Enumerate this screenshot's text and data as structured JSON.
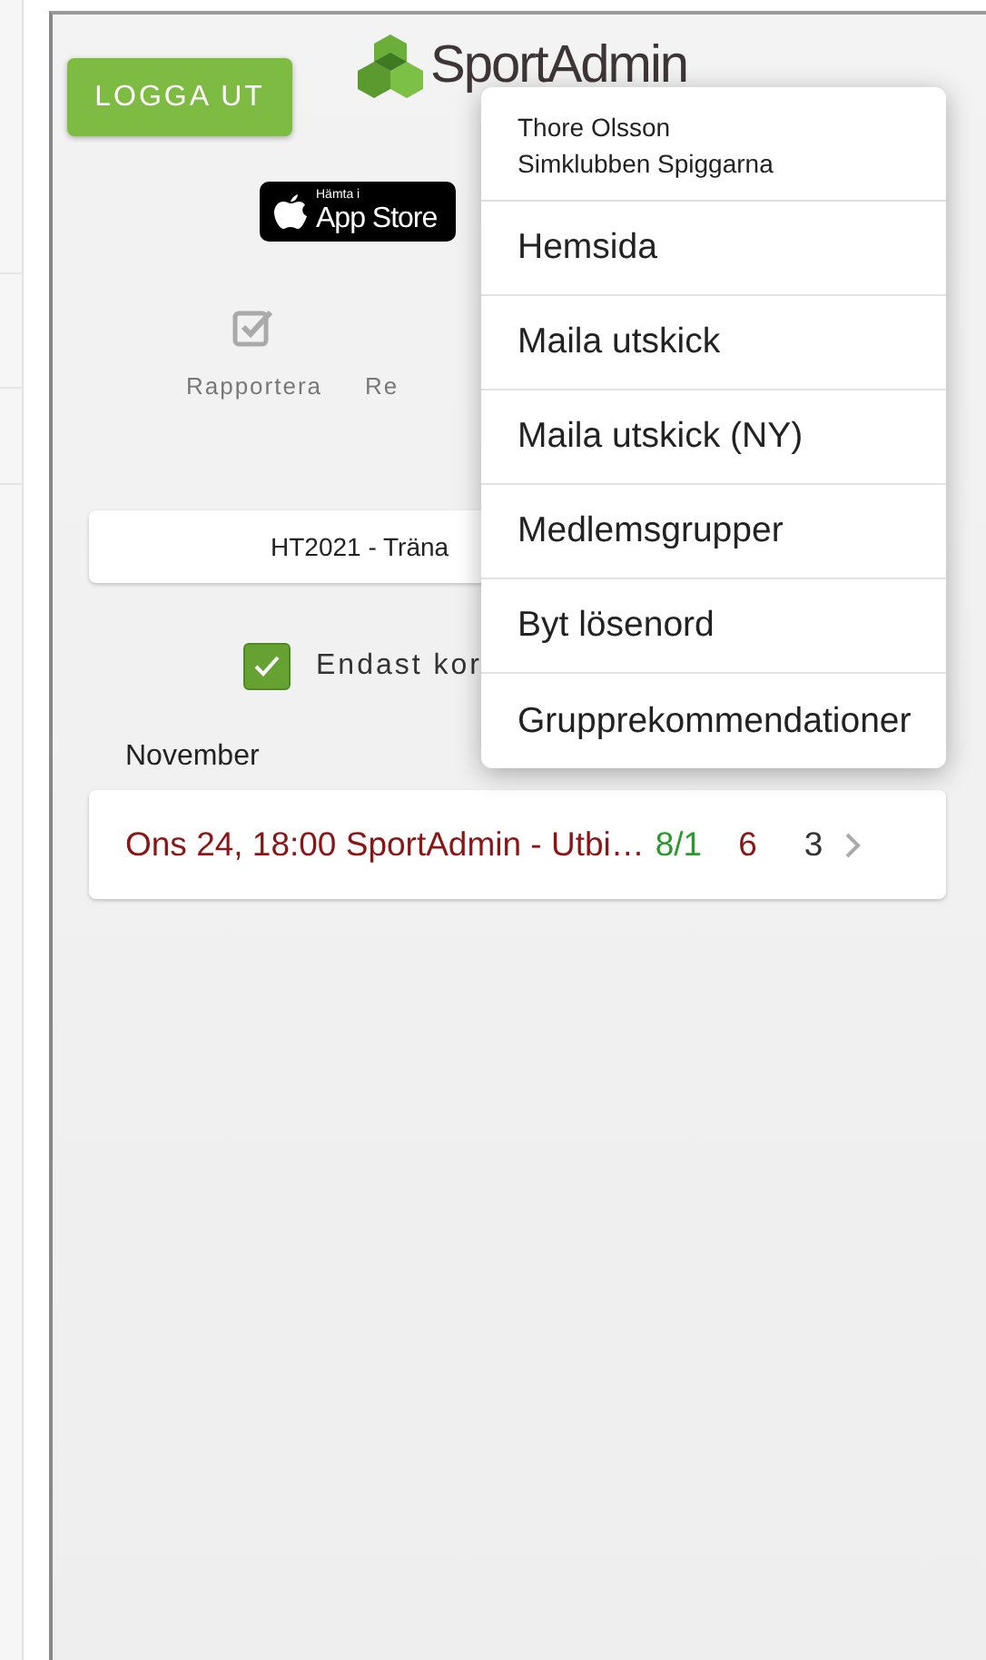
{
  "header": {
    "logout_button": "LOGGA UT",
    "logo": "SportAdmin"
  },
  "app_store_badge": {
    "small_text": "Hämta i",
    "text": "App Store"
  },
  "actions": [
    {
      "label": "Rapportera",
      "kind": "check"
    },
    {
      "label": "Re",
      "kind": "text"
    }
  ],
  "group_select": {
    "value": "HT2021 - Träna"
  },
  "filter": {
    "label": "Endast kor",
    "checked": true
  },
  "month": "November",
  "events": [
    {
      "title": "Ons 24, 18:00 SportAdmin - Utbi…",
      "ratio": "8/1",
      "count_a": "6",
      "count_b": "3"
    }
  ],
  "menu": {
    "user_name": "Thore Olsson",
    "club": "Simklubben Spiggarna",
    "items": [
      "Hemsida",
      "Maila utskick",
      "Maila utskick (NY)",
      "Medlemsgrupper",
      "Byt lösenord",
      "Grupprekommendationer"
    ]
  }
}
